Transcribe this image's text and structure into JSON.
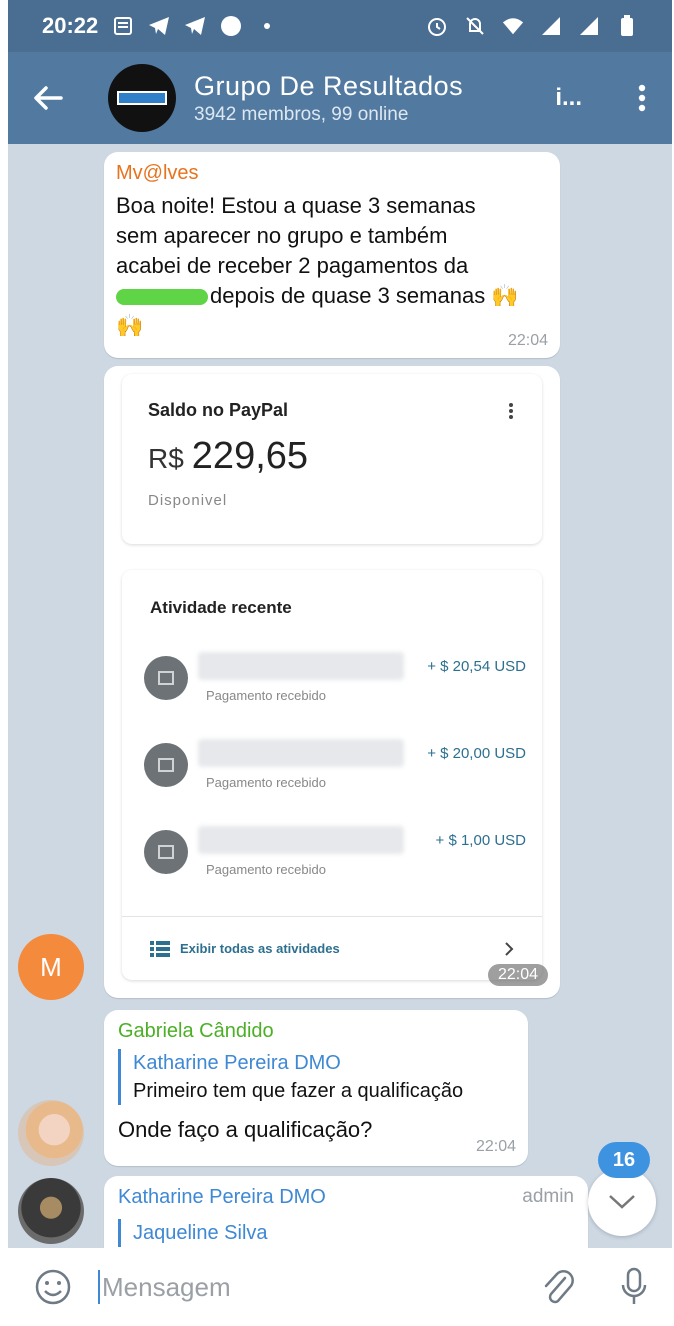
{
  "status_bar": {
    "time": "20:22"
  },
  "header": {
    "title": "Grupo De Resultados",
    "subtitle": "3942 membros, 99 online",
    "extra": "i..."
  },
  "messages": {
    "m1": {
      "sender": "Mv@lves",
      "sender_color": "#e8731f",
      "text_line1": "Boa noite! Estou a quase 3 semanas",
      "text_line2": "sem aparecer no grupo e também",
      "text_line3": "acabei de receber 2 pagamentos da",
      "text_line4": "depois de quase 3 semanas 🙌",
      "text_line5": "🙌",
      "time": "22:04"
    },
    "m2": {
      "time": "22:04",
      "paypal": {
        "balance_title": "Saldo no PayPal",
        "currency": "R$",
        "amount": "229,65",
        "available": "Disponivel",
        "activity_title": "Atividade recente",
        "rows": [
          {
            "desc": "Pagamento recebido",
            "value": "+ $ 20,54 USD"
          },
          {
            "desc": "Pagamento recebido",
            "value": "+ $ 20,00 USD"
          },
          {
            "desc": "Pagamento recebido",
            "value": "+ $ 1,00 USD"
          }
        ],
        "footer": "Exibir todas as atividades"
      }
    },
    "m3": {
      "sender": "Gabriela Cândido",
      "sender_color": "#4caf26",
      "reply_name": "Katharine Pereira DMO",
      "reply_text": "Primeiro tem que fazer a qualificação",
      "text": "Onde faço a qualificação?",
      "time": "22:04"
    },
    "m4": {
      "sender": "Katharine Pereira DMO",
      "role": "admin",
      "reply_name": "Jaqueline Silva"
    }
  },
  "avatar_m": {
    "letter": "M",
    "color": "#f48a3c"
  },
  "unread_badge": "16",
  "input": {
    "placeholder": "Mensagem"
  },
  "colors": {
    "header": "#527aa0",
    "status": "#4a6d92",
    "accent": "#3e88d4"
  }
}
